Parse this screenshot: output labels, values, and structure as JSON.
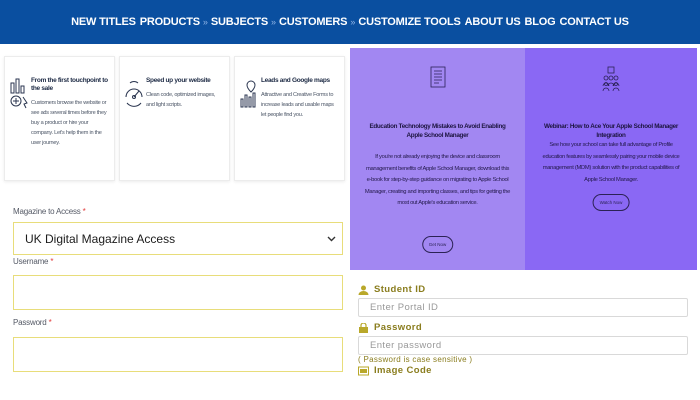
{
  "topnav": {
    "items": [
      "NEW TITLES",
      "PRODUCTS",
      "SUBJECTS",
      "CUSTOMERS",
      "CUSTOMIZE TOOLS",
      "ABOUT US",
      "BLOG",
      "CONTACT US"
    ],
    "separator": "»"
  },
  "features": [
    {
      "icon": "chart-touch-icon",
      "title": "From the first touchpoint to the sale",
      "desc": "Customers browse the website or see ads several times before they buy a product or hire your company. Let's help them in the user journey."
    },
    {
      "icon": "speedometer-icon",
      "title": "Speed up your website",
      "desc": "Clean code, optimized images, and light scripts."
    },
    {
      "icon": "map-pin-chart-icon",
      "title": "Leads and Google maps",
      "desc": "Attractive and Creative Forms to increase leads and usable maps let people find you."
    }
  ],
  "form": {
    "magazine_label": "Magazine to Access",
    "required_mark": "*",
    "magazine_value": "UK Digital Magazine Access",
    "username_label": "Username",
    "password_label": "Password"
  },
  "promos": [
    {
      "icon": "document-list-icon",
      "title": "Education Technology Mistakes to Avoid Enabling Apple School Manager",
      "desc": "If you're not already enjoying the device and classroom management benefits of Apple School Manager, download this e-book for step-by-step guidance on migrating to Apple School Manager, creating and importing classes, and tips for getting the most out Apple's education service.",
      "button": "Get Now"
    },
    {
      "icon": "people-group-icon",
      "title": "Webinar: How to Ace Your Apple School Manager Integration",
      "desc": "See how your school can take full advantage of Profile education features by seamlessly pairing your mobile device management (MDM) solution with the product capabilities of Apple School Manager.",
      "button": "Watch Now"
    }
  ],
  "portal": {
    "student_label": "Student ID",
    "student_placeholder": "Enter Portal ID",
    "password_label": "Password",
    "password_placeholder": "Enter password",
    "password_note": "( Password is case sensitive )",
    "image_label": "Image Code"
  },
  "colors": {
    "nav": "#0a4fa0",
    "promo1": "#a287f2",
    "promo2": "#8a68f4",
    "accent": "#8a7d1e",
    "field_border": "#e8dd7a"
  }
}
